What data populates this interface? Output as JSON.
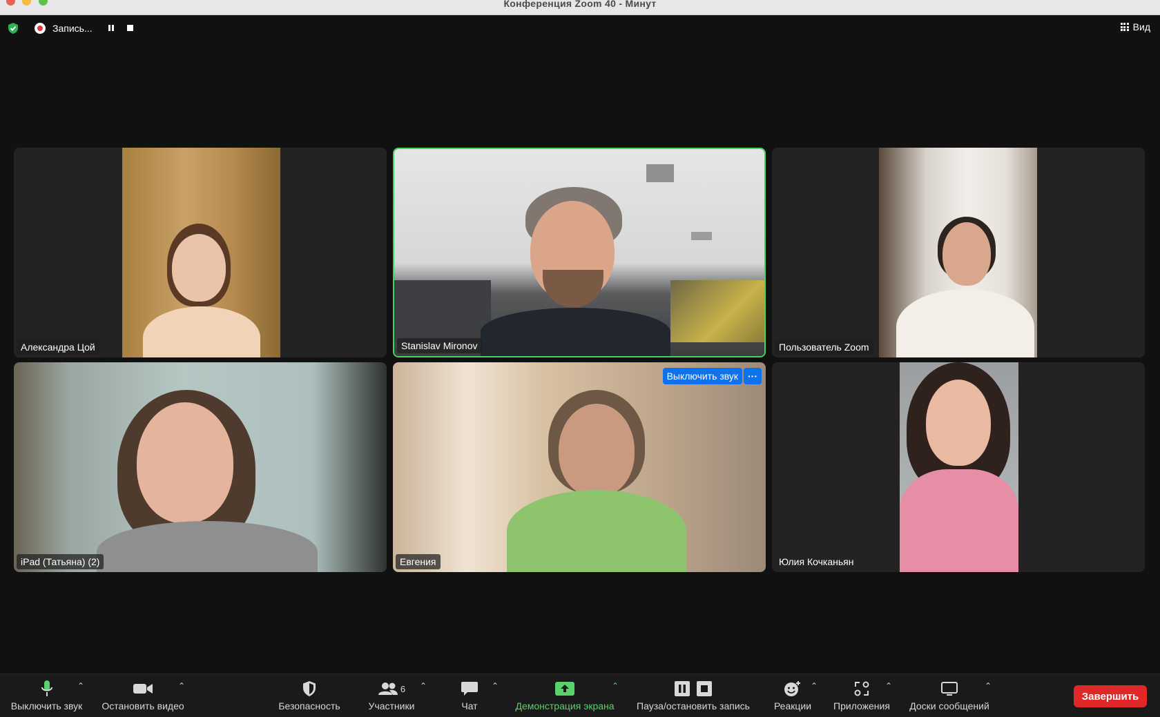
{
  "window": {
    "title": "Конференция Zoom   40 - Минут"
  },
  "topbar": {
    "recording_label": "Запись...",
    "view_label": "Вид"
  },
  "participants": [
    {
      "name": "Александра Цой"
    },
    {
      "name": "Stanislav Mironov"
    },
    {
      "name": "Пользователь Zoom"
    },
    {
      "name": "iPad (Татьяна) (2)"
    },
    {
      "name": "Евгения"
    },
    {
      "name": "Юлия Кочканьян"
    }
  ],
  "tile_actions": {
    "mute_label": "Выключить звук",
    "more_label": "···"
  },
  "toolbar": {
    "mute": "Выключить звук",
    "video": "Остановить видео",
    "security": "Безопасность",
    "participants": "Участники",
    "participants_count": "6",
    "chat": "Чат",
    "share": "Демонстрация экрана",
    "record": "Пауза/остановить запись",
    "reactions": "Реакции",
    "apps": "Приложения",
    "whiteboards": "Доски сообщений",
    "end": "Завершить"
  },
  "colors": {
    "accent_green": "#59d26c",
    "active_speaker": "#4dd15d",
    "end_red": "#e02828",
    "blue": "#0e72ed"
  }
}
